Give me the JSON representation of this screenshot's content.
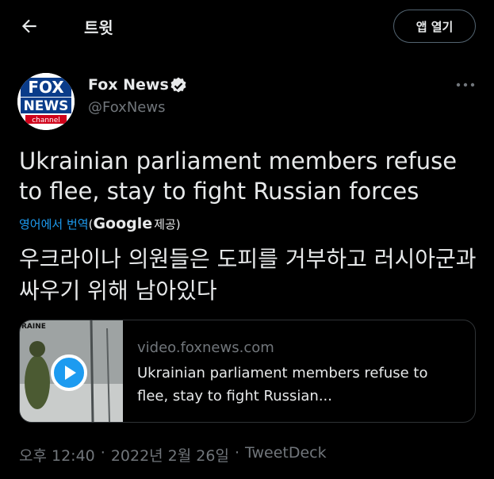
{
  "header": {
    "title": "트윗",
    "open_app_label": "앱 열기"
  },
  "author": {
    "name": "Fox News",
    "handle": "@FoxNews",
    "logo_text_top": "FOX",
    "logo_text_mid": "NEWS",
    "logo_text_bottom": "channel",
    "verified": true
  },
  "tweet": {
    "text": "Ukrainian parliament members refuse to flee, stay to fight Russian forces",
    "translate_link": "영어에서 번역",
    "translate_open": "(",
    "translate_provider": "Google",
    "translate_suffix": "제공)",
    "translated_text": "우크라이나 의원들은 도피를 거부하고 러시아군과 싸우기 위해 남아있다"
  },
  "card": {
    "domain": "video.foxnews.com",
    "title": "Ukrainian parliament members refuse to flee, stay to fight Russian...",
    "thumb_label": "RAINE"
  },
  "meta": {
    "time": "오후 12:40",
    "date": "2022년 2월 26일",
    "separator": "·",
    "source": "TweetDeck"
  },
  "colors": {
    "background": "#000000",
    "accent": "#1d9bf0",
    "text": "#e7e9ea",
    "muted": "#71767b"
  }
}
